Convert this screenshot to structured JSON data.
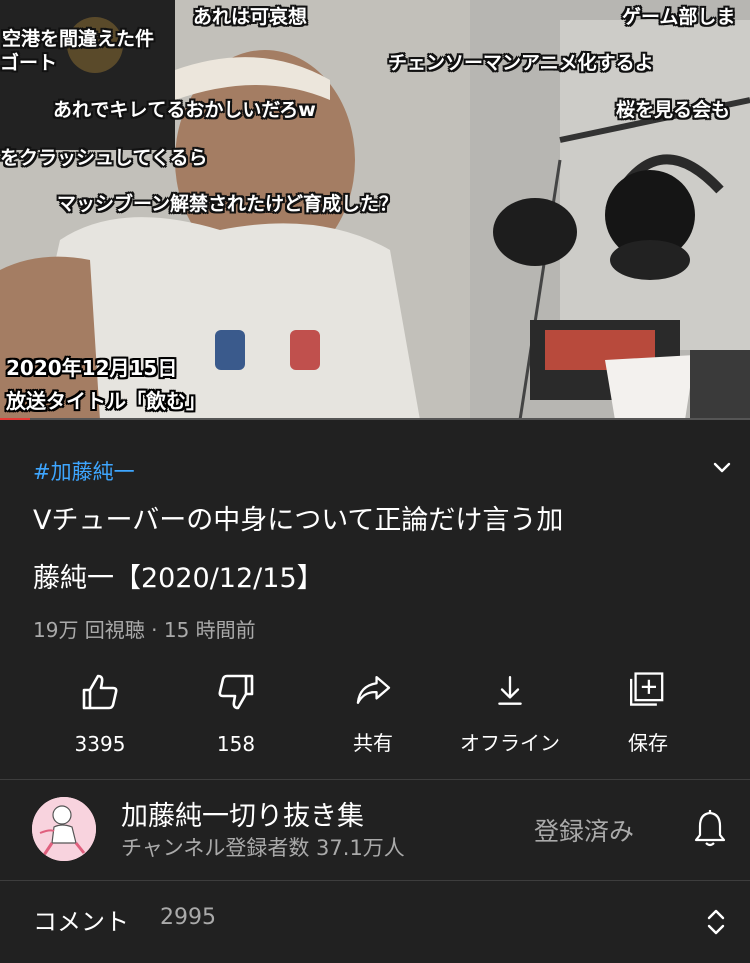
{
  "video": {
    "danmaku": [
      "あれは可哀想",
      "ゲーム部しま",
      "空港を間違えた件",
      "ゴート",
      "チェンソーマンアニメ化するよ",
      "あれでキレてるおかしいだろw",
      "桜を見る会も",
      "をクラッシュしてくるら",
      "マッシブーン解禁されたけど育成した？"
    ],
    "caption_date": "2020年12月15日",
    "caption_title": "放送タイトル「飲む」",
    "progress": 0.04
  },
  "info": {
    "hashtag": "#加藤純一",
    "title_line1": "Vチューバーの中身について正論だけ言う加",
    "title_line2": "藤純一【2020/12/15】",
    "meta": "19万 回視聴 · 15 時間前"
  },
  "actions": {
    "like_count": "3395",
    "dislike_count": "158",
    "share_label": "共有",
    "offline_label": "オフライン",
    "save_label": "保存"
  },
  "channel": {
    "name": "加藤純一切り抜き集",
    "subscribers": "チャンネル登録者数 37.1万人",
    "subscribed_label": "登録済み"
  },
  "comments": {
    "label": "コメント",
    "count": "2995"
  },
  "colors": {
    "background": "#212121",
    "hashtag": "#3ea6ff",
    "secondary_text": "#aaaaaa",
    "progress": "#e53935"
  }
}
